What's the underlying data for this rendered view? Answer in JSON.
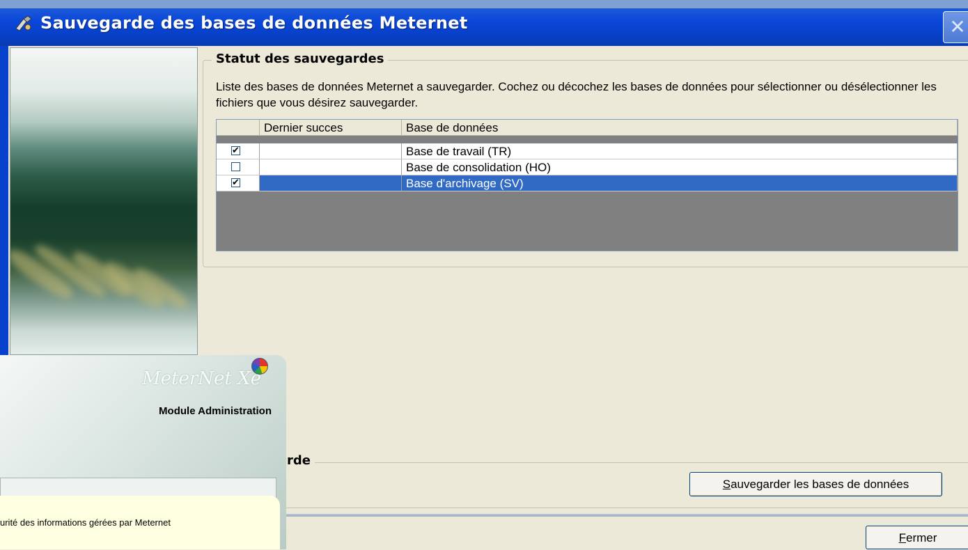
{
  "window": {
    "title": "Sauvegarde des bases de données Meternet",
    "close_glyph": "✕"
  },
  "status_group": {
    "title": "Statut des sauvegardes",
    "description": "Liste des bases de données Meternet a sauvegarder. Cochez ou décochez les bases de données pour sélectionner ou désélectionner les fichiers que vous désirez sauvegarder."
  },
  "grid": {
    "columns": [
      "",
      "Dernier succes",
      "Base de données"
    ],
    "rows": [
      {
        "checked": true,
        "last_success": "",
        "database": "Base de travail (TR)",
        "selected": false
      },
      {
        "checked": false,
        "last_success": "",
        "database": "Base de consolidation (HO)",
        "selected": false
      },
      {
        "checked": true,
        "last_success": "",
        "database": "Base d'archivage (SV)",
        "selected": true
      }
    ]
  },
  "backup_group": {
    "title_partial": "rde",
    "save_button_accel": "S",
    "save_button_rest": "auvegarder les bases de données"
  },
  "footer": {
    "close_button_accel": "F",
    "close_button_rest": "ermer"
  },
  "splash": {
    "logo_text": "MeterNet Xe",
    "module_label": "Module Administration",
    "info_text": "urité des informations gérées par Meternet"
  }
}
